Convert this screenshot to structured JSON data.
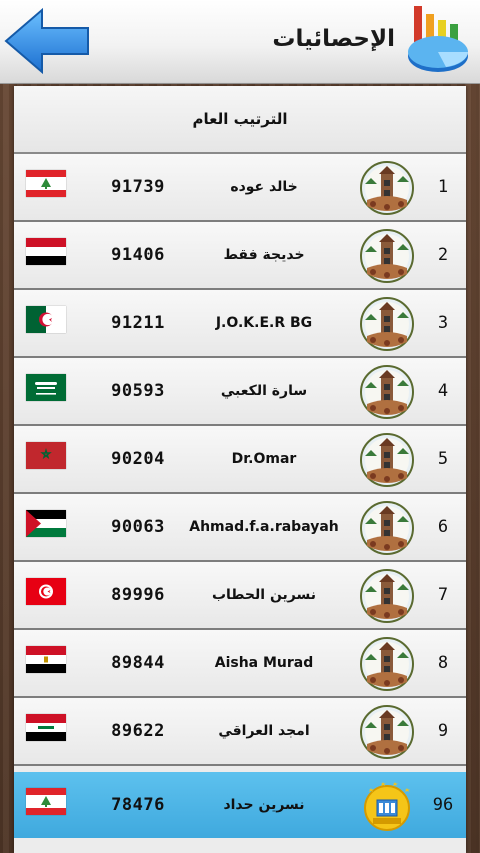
{
  "header": {
    "title": "الإحصائيات",
    "back_icon": "back-arrow-icon",
    "stats_icon": "stats-chart-icon"
  },
  "panel": {
    "title": "الترتيب العام"
  },
  "rows": [
    {
      "rank": "1",
      "name": "خالد عوده",
      "score": "91739",
      "flag": "lebanon"
    },
    {
      "rank": "2",
      "name": "خديجة فقط",
      "score": "91406",
      "flag": "yemen"
    },
    {
      "rank": "3",
      "name": "J.O.K.E.R BG",
      "score": "91211",
      "flag": "algeria"
    },
    {
      "rank": "4",
      "name": "سارة الكعبي",
      "score": "90593",
      "flag": "saudi-arabia"
    },
    {
      "rank": "5",
      "name": "Dr.Omar",
      "score": "90204",
      "flag": "morocco"
    },
    {
      "rank": "6",
      "name": "Ahmad.f.a.rabayah",
      "score": "90063",
      "flag": "palestine"
    },
    {
      "rank": "7",
      "name": "نسرين الحطاب",
      "score": "89996",
      "flag": "tunisia"
    },
    {
      "rank": "8",
      "name": "Aisha Murad",
      "score": "89844",
      "flag": "egypt"
    },
    {
      "rank": "9",
      "name": "امجد العراقي",
      "score": "89622",
      "flag": "iraq"
    }
  ],
  "current_user": {
    "rank": "96",
    "name": "نسرين حداد",
    "score": "78476",
    "flag": "lebanon"
  },
  "colors": {
    "highlight": "#4db6e8",
    "back_arrow": "#2f8fe0"
  }
}
